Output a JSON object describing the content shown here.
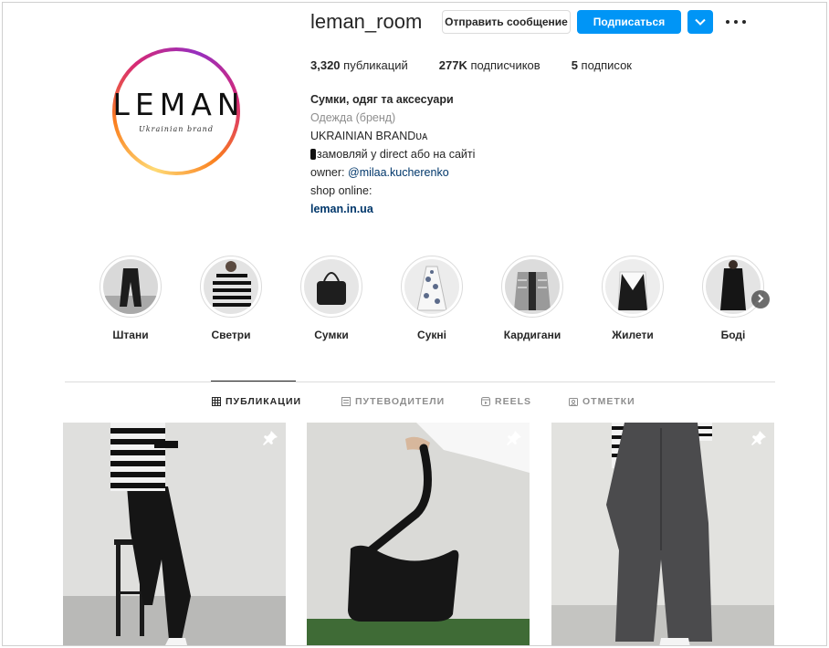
{
  "profile": {
    "username": "leman_room",
    "avatar": {
      "logo_word": "LEMAN",
      "logo_sub": "Ukrainian brand"
    },
    "buttons": {
      "message": "Отправить сообщение",
      "follow": "Подписаться",
      "dropdown_icon": "chevron-down-icon",
      "more_icon": "more-dots-icon"
    },
    "stats": [
      {
        "value": "3,320",
        "label": "публикаций"
      },
      {
        "value": "277K",
        "label": "подписчиков"
      },
      {
        "value": "5",
        "label": "подписок"
      }
    ],
    "bio": {
      "name": "Сумки, одяг та аксесуари",
      "category": "Одежда (бренд)",
      "line1": "UKRAINIAN BRANDᴜᴀ",
      "line2": "замовляй у direct або на сайті",
      "owner_prefix": "owner: ",
      "owner_mention": "@milaa.kucherenko",
      "shop": "shop online:",
      "link": "leman.in.ua"
    }
  },
  "highlights": [
    {
      "label": "Штани"
    },
    {
      "label": "Светри"
    },
    {
      "label": "Сумки"
    },
    {
      "label": "Сукні"
    },
    {
      "label": "Кардигани"
    },
    {
      "label": "Жилети"
    },
    {
      "label": "Боді"
    }
  ],
  "tabs": [
    {
      "label": "ПУБЛИКАЦИИ",
      "icon": "grid-icon",
      "active": true
    },
    {
      "label": "ПУТЕВОДИТЕЛИ",
      "icon": "guide-icon",
      "active": false
    },
    {
      "label": "REELS",
      "icon": "reels-icon",
      "active": false
    },
    {
      "label": "ОТМЕТКИ",
      "icon": "tagged-icon",
      "active": false
    }
  ],
  "posts": [
    {
      "subject": "striped sweater and black trousers on stool",
      "pinned": true
    },
    {
      "subject": "black shoulder bag held in hand",
      "pinned": true
    },
    {
      "subject": "grey wide trousers",
      "pinned": true
    }
  ],
  "colors": {
    "primary": "#0095f6",
    "text": "#262626",
    "secondary": "#8e8e8e",
    "link": "#00376b",
    "border": "#dbdbdb"
  }
}
